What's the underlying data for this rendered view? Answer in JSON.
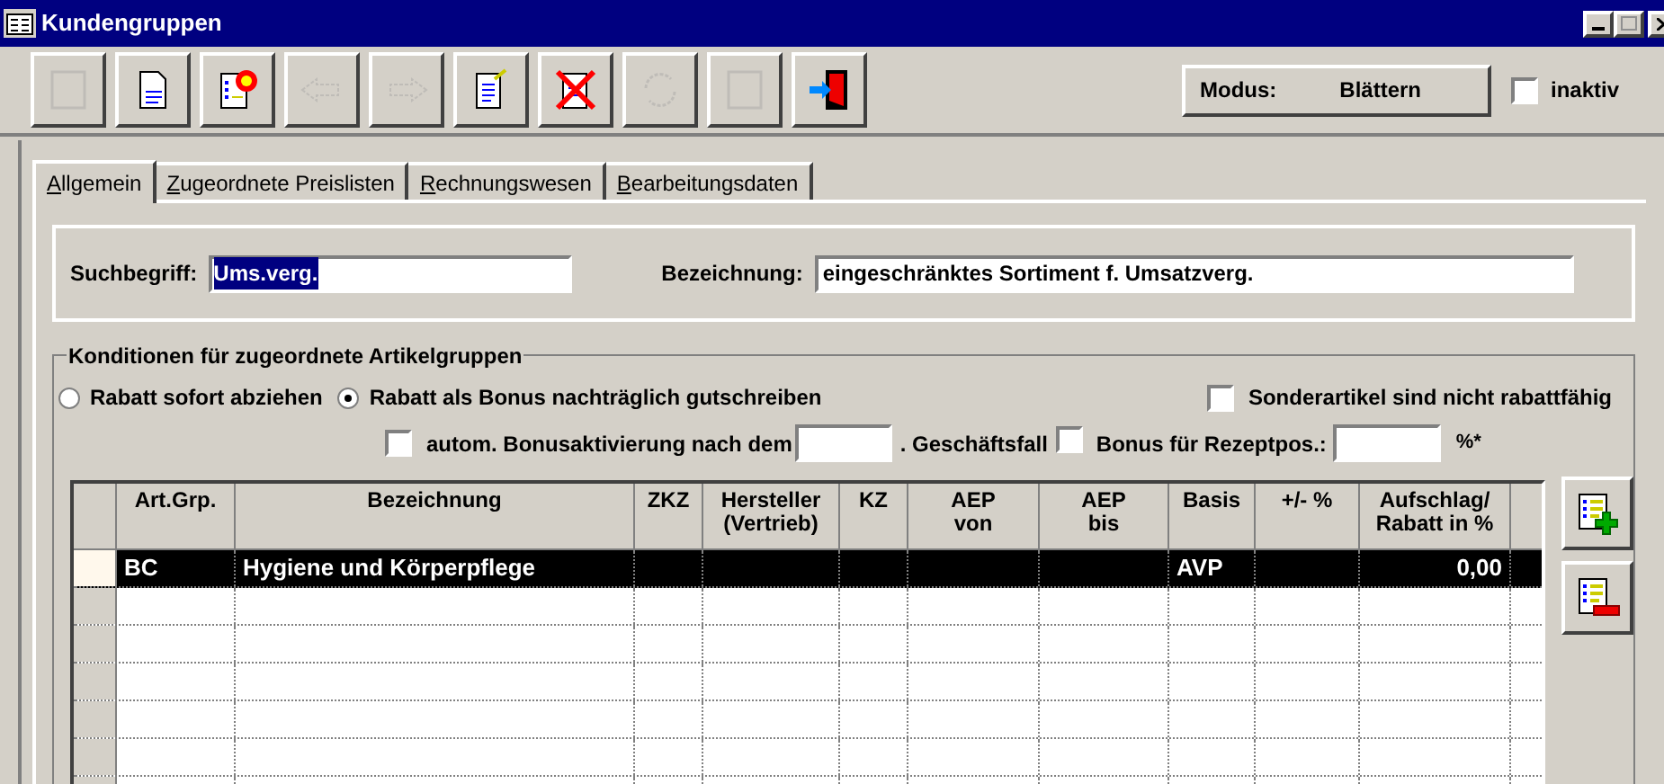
{
  "window": {
    "title": "Kundengruppen"
  },
  "toolbar": [
    {
      "kind": "blank",
      "disabled": true
    },
    {
      "kind": "document",
      "disabled": false
    },
    {
      "kind": "list-target",
      "disabled": false
    },
    {
      "kind": "arrow-left",
      "disabled": true
    },
    {
      "kind": "arrow-right",
      "disabled": true
    },
    {
      "kind": "document-edit",
      "disabled": false
    },
    {
      "kind": "delete",
      "disabled": false
    },
    {
      "kind": "refresh",
      "disabled": true
    },
    {
      "kind": "blank",
      "disabled": true
    },
    {
      "kind": "exit",
      "disabled": false
    }
  ],
  "mode": {
    "label": "Modus:",
    "value": "Blättern"
  },
  "inaktiv": {
    "label": "inaktiv",
    "checked": false
  },
  "tabs": [
    {
      "label": "Allgemein",
      "selected": true
    },
    {
      "label": "Zugeordnete Preislisten",
      "selected": false
    },
    {
      "label": "Rechnungswesen",
      "selected": false
    },
    {
      "label": "Bearbeitungsdaten",
      "selected": false
    }
  ],
  "suchbegriff": {
    "label": "Suchbegriff:",
    "value": "Ums.verg."
  },
  "bezeichnung": {
    "label": "Bezeichnung:",
    "value": "eingeschränktes Sortiment f. Umsatzverg."
  },
  "konditionen": {
    "title": "Konditionen für zugeordnete Artikelgruppen",
    "radios": [
      {
        "label": "Rabatt sofort abziehen",
        "selected": false
      },
      {
        "label": "Rabatt als Bonus nachträglich gutschreiben",
        "selected": true
      }
    ],
    "sonderartikel": {
      "label": "Sonderartikel sind nicht rabattfähig",
      "checked": false
    },
    "bonusaktivierung": {
      "label": "autom. Bonusaktivierung nach dem",
      "suffix": ". Geschäftsfall",
      "checked": false
    },
    "rezeptpos": {
      "label": "Bonus für Rezeptpos.:",
      "unit": "%*",
      "checked": false
    }
  },
  "table": {
    "columns": [
      {
        "label": "Art.Grp."
      },
      {
        "label": "Bezeichnung"
      },
      {
        "label": "ZKZ"
      },
      {
        "label": "Hersteller (Vertrieb)"
      },
      {
        "label": "KZ"
      },
      {
        "label": "AEP von"
      },
      {
        "label": "AEP bis"
      },
      {
        "label": "Basis"
      },
      {
        "label": "+/- %"
      },
      {
        "label": "Aufschlag/ Rabatt in %"
      }
    ],
    "rows": [
      {
        "art_grp": "BC",
        "bezeichnung": "Hygiene und Körperpflege",
        "basis": "AVP",
        "aufschlag_rabatt": "0,00",
        "selected": true
      }
    ]
  }
}
